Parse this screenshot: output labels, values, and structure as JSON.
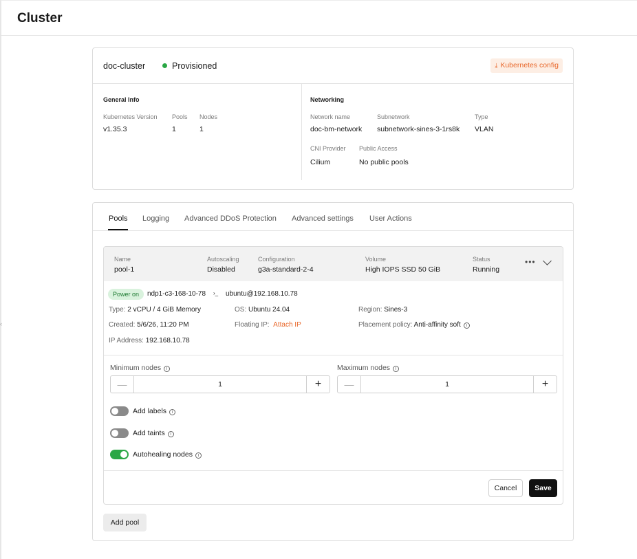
{
  "page": {
    "title": "Cluster"
  },
  "cluster": {
    "name": "doc-cluster",
    "status": "Provisioned",
    "kube_config_label": "Kubernetes config",
    "general": {
      "title": "General Info",
      "version_label": "Kubernetes Version",
      "version": "v1.35.3",
      "pools_label": "Pools",
      "pools": "1",
      "nodes_label": "Nodes",
      "nodes": "1"
    },
    "networking": {
      "title": "Networking",
      "network_name_label": "Network name",
      "network_name": "doc-bm-network",
      "subnetwork_label": "Subnetwork",
      "subnetwork": "subnetwork-sines-3-1rs8k",
      "type_label": "Type",
      "type": "VLAN",
      "cni_label": "CNI Provider",
      "cni": "Cilium",
      "public_label": "Public Access",
      "public": "No public pools"
    }
  },
  "tabs": [
    "Pools",
    "Logging",
    "Advanced DDoS Protection",
    "Advanced settings",
    "User Actions"
  ],
  "pool": {
    "name_label": "Name",
    "name": "pool-1",
    "autoscaling_label": "Autoscaling",
    "autoscaling": "Disabled",
    "configuration_label": "Configuration",
    "configuration": "g3a-standard-2-4",
    "volume_label": "Volume",
    "volume": "High IOPS SSD 50 GiB",
    "status_label": "Status",
    "status": "Running",
    "node": {
      "power": "Power on",
      "hostname": "ndp1-c3-168-10-78",
      "ssh_prefix": "›_",
      "ssh": "ubuntu@192.168.10.78",
      "type_label": "Type:",
      "type": "2 vCPU / 4 GiB Memory",
      "os_label": "OS:",
      "os": "Ubuntu 24.04",
      "region_label": "Region:",
      "region": "Sines-3",
      "created_label": "Created:",
      "created": "5/6/26, 11:20 PM",
      "floating_label": "Floating IP:",
      "floating": "Attach IP",
      "placement_label": "Placement policy:",
      "placement": "Anti-affinity soft",
      "ip_label": "IP Address:",
      "ip": "192.168.10.78"
    },
    "min_label": "Minimum nodes",
    "min_value": "1",
    "max_label": "Maximum nodes",
    "max_value": "1",
    "toggles": {
      "labels": "Add labels",
      "taints": "Add taints",
      "autohealing": "Autohealing nodes"
    },
    "cancel": "Cancel",
    "save": "Save"
  },
  "add_pool": "Add pool",
  "icons": {
    "download": "download-icon",
    "info": "info-icon",
    "more": "more-icon",
    "chevron": "chevron-down-icon"
  },
  "colors": {
    "accent": "#e8672a",
    "success": "#2aa745",
    "primary_button": "#111111"
  }
}
